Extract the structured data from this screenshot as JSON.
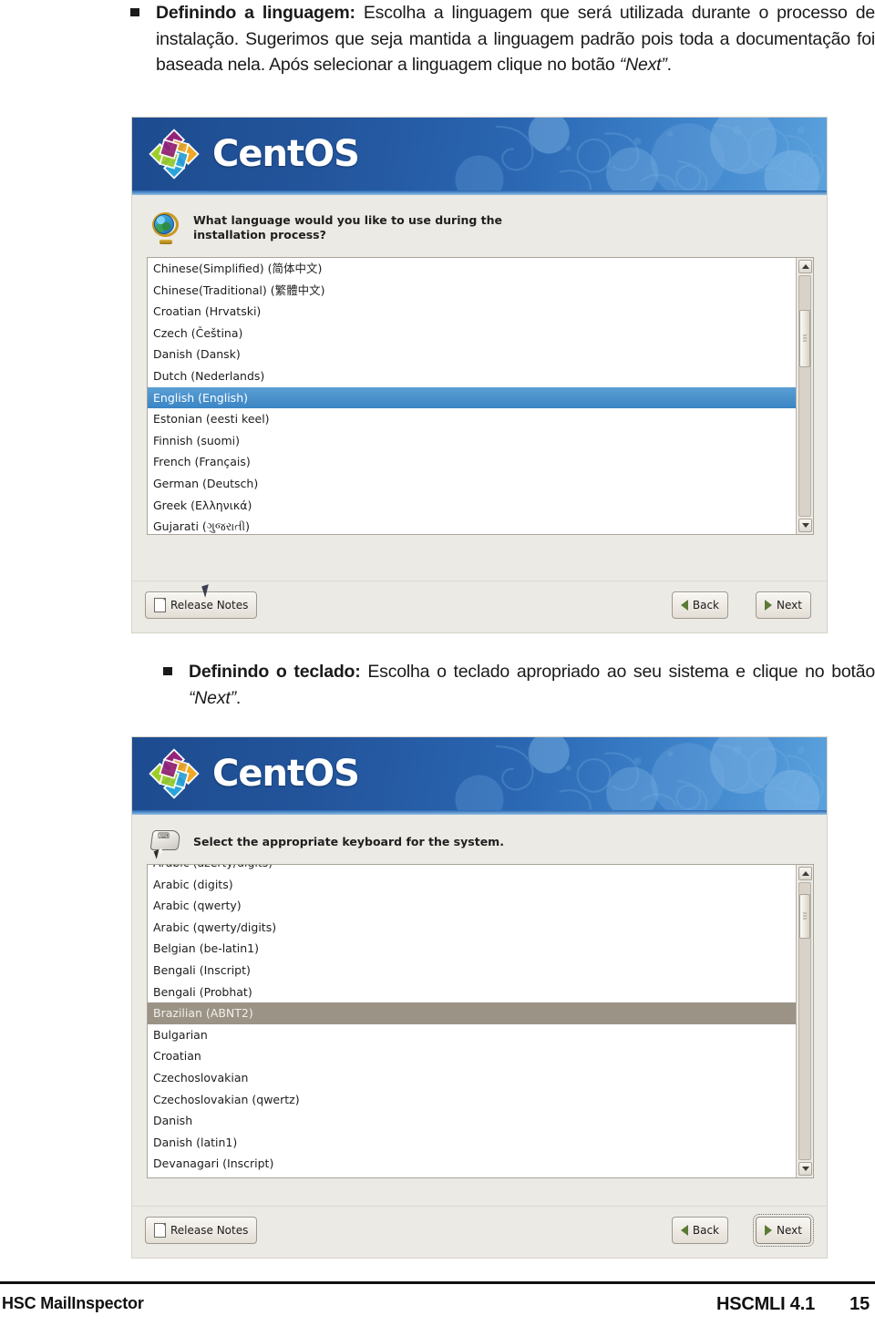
{
  "document": {
    "paragraph1": {
      "bold_lead": "Definindo a linguagem:",
      "rest": " Escolha a linguagem que será utilizada durante o processo de instalação. Sugerimos que seja mantida a linguagem padrão pois toda a documentação foi baseada nela. Após selecionar a linguagem clique no botão ",
      "quoted": "“Next”",
      "tail": "."
    },
    "paragraph2": {
      "bold_lead": "Definindo o teclado:",
      "rest": " Escolha o teclado apropriado ao seu sistema e clique no botão ",
      "quoted": "“Next”",
      "tail": "."
    }
  },
  "screenshot_language": {
    "banner": {
      "logo_text": "CentOS"
    },
    "prompt": "What language would you like to use during the\ninstallation process?",
    "list": {
      "items": [
        "Chinese(Simplified) (简体中文)",
        "Chinese(Traditional) (繁體中文)",
        "Croatian (Hrvatski)",
        "Czech (Čeština)",
        "Danish (Dansk)",
        "Dutch (Nederlands)",
        "English (English)",
        "Estonian (eesti keel)",
        "Finnish (suomi)",
        "French (Français)",
        "German (Deutsch)",
        "Greek (Ελληνικά)",
        "Gujarati (ગુજરાતી)"
      ],
      "selected": "English (English)",
      "selected_index": 6,
      "selection_color": "#3a85c4"
    },
    "buttons": {
      "release_notes": "Release Notes",
      "back": "Back",
      "next": "Next"
    }
  },
  "screenshot_keyboard": {
    "banner": {
      "logo_text": "CentOS"
    },
    "prompt": "Select the appropriate keyboard for the system.",
    "list": {
      "items": [
        "Arabic (azerty/digits)",
        "Arabic (digits)",
        "Arabic (qwerty)",
        "Arabic (qwerty/digits)",
        "Belgian (be-latin1)",
        "Bengali (Inscript)",
        "Bengali (Probhat)",
        "Brazilian (ABNT2)",
        "Bulgarian",
        "Croatian",
        "Czechoslovakian",
        "Czechoslovakian (qwertz)",
        "Danish",
        "Danish (latin1)",
        "Devanagari (Inscript)"
      ],
      "selected": "Brazilian (ABNT2)",
      "selected_index": 7,
      "selection_color": "#9b9386"
    },
    "buttons": {
      "release_notes": "Release Notes",
      "back": "Back",
      "next": "Next"
    }
  },
  "footer": {
    "left": "HSC MailInspector",
    "product": "HSCMLI 4.1",
    "page_number": "15"
  }
}
